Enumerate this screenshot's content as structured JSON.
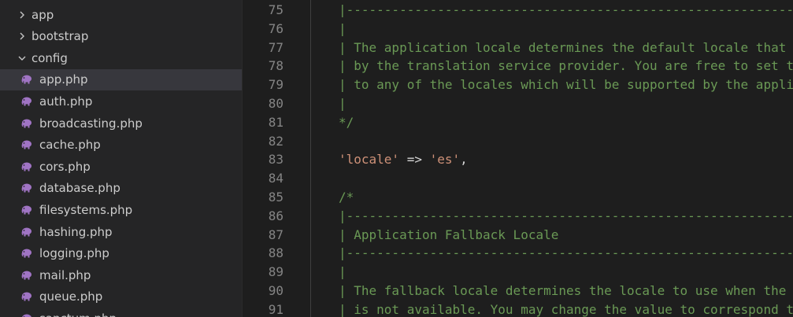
{
  "explorer": {
    "items": [
      {
        "type": "folder",
        "label": "app",
        "state": "collapsed",
        "icon": "chevron-right-icon"
      },
      {
        "type": "folder",
        "label": "bootstrap",
        "state": "collapsed",
        "icon": "chevron-right-icon"
      },
      {
        "type": "folder",
        "label": "config",
        "state": "expanded",
        "icon": "chevron-down-icon"
      },
      {
        "type": "file",
        "label": "app.php",
        "icon": "php-elephant-icon",
        "selected": true
      },
      {
        "type": "file",
        "label": "auth.php",
        "icon": "php-elephant-icon"
      },
      {
        "type": "file",
        "label": "broadcasting.php",
        "icon": "php-elephant-icon"
      },
      {
        "type": "file",
        "label": "cache.php",
        "icon": "php-elephant-icon"
      },
      {
        "type": "file",
        "label": "cors.php",
        "icon": "php-elephant-icon"
      },
      {
        "type": "file",
        "label": "database.php",
        "icon": "php-elephant-icon"
      },
      {
        "type": "file",
        "label": "filesystems.php",
        "icon": "php-elephant-icon"
      },
      {
        "type": "file",
        "label": "hashing.php",
        "icon": "php-elephant-icon"
      },
      {
        "type": "file",
        "label": "logging.php",
        "icon": "php-elephant-icon"
      },
      {
        "type": "file",
        "label": "mail.php",
        "icon": "php-elephant-icon"
      },
      {
        "type": "file",
        "label": "queue.php",
        "icon": "php-elephant-icon"
      },
      {
        "type": "file",
        "label": "sanctum.php",
        "icon": "php-elephant-icon"
      }
    ]
  },
  "editor": {
    "lines": [
      {
        "n": "75",
        "parts": [
          {
            "t": "|------------------------------------------------------------",
            "k": "c"
          }
        ]
      },
      {
        "n": "76",
        "parts": [
          {
            "t": "|",
            "k": "c"
          }
        ]
      },
      {
        "n": "77",
        "parts": [
          {
            "t": "| The application locale determines the default locale that",
            "k": "c"
          }
        ]
      },
      {
        "n": "78",
        "parts": [
          {
            "t": "| by the translation service provider. You are free to set t",
            "k": "c"
          }
        ]
      },
      {
        "n": "79",
        "parts": [
          {
            "t": "| to any of the locales which will be supported by the appli",
            "k": "c"
          }
        ]
      },
      {
        "n": "80",
        "parts": [
          {
            "t": "|",
            "k": "c"
          }
        ]
      },
      {
        "n": "81",
        "parts": [
          {
            "t": "*/",
            "k": "c"
          }
        ]
      },
      {
        "n": "82",
        "parts": []
      },
      {
        "n": "83",
        "parts": [
          {
            "t": "'locale'",
            "k": "s"
          },
          {
            "t": " => ",
            "k": "p"
          },
          {
            "t": "'es'",
            "k": "s"
          },
          {
            "t": ",",
            "k": "p"
          }
        ]
      },
      {
        "n": "84",
        "parts": []
      },
      {
        "n": "85",
        "parts": [
          {
            "t": "/*",
            "k": "c"
          }
        ]
      },
      {
        "n": "86",
        "parts": [
          {
            "t": "|------------------------------------------------------------",
            "k": "c"
          }
        ]
      },
      {
        "n": "87",
        "parts": [
          {
            "t": "| Application Fallback Locale",
            "k": "c"
          }
        ]
      },
      {
        "n": "88",
        "parts": [
          {
            "t": "|------------------------------------------------------------",
            "k": "c"
          }
        ]
      },
      {
        "n": "89",
        "parts": [
          {
            "t": "|",
            "k": "c"
          }
        ]
      },
      {
        "n": "90",
        "parts": [
          {
            "t": "| The fallback locale determines the locale to use when the ",
            "k": "c"
          }
        ]
      },
      {
        "n": "91",
        "parts": [
          {
            "t": "| is not available. You may change the value to correspond t",
            "k": "c"
          }
        ]
      }
    ]
  },
  "colors": {
    "comment": "#6a9955",
    "string": "#ce9178",
    "plain": "#d4d4d4",
    "line_number": "#858585",
    "selection": "#37373d",
    "php_icon": "#a074c4"
  }
}
